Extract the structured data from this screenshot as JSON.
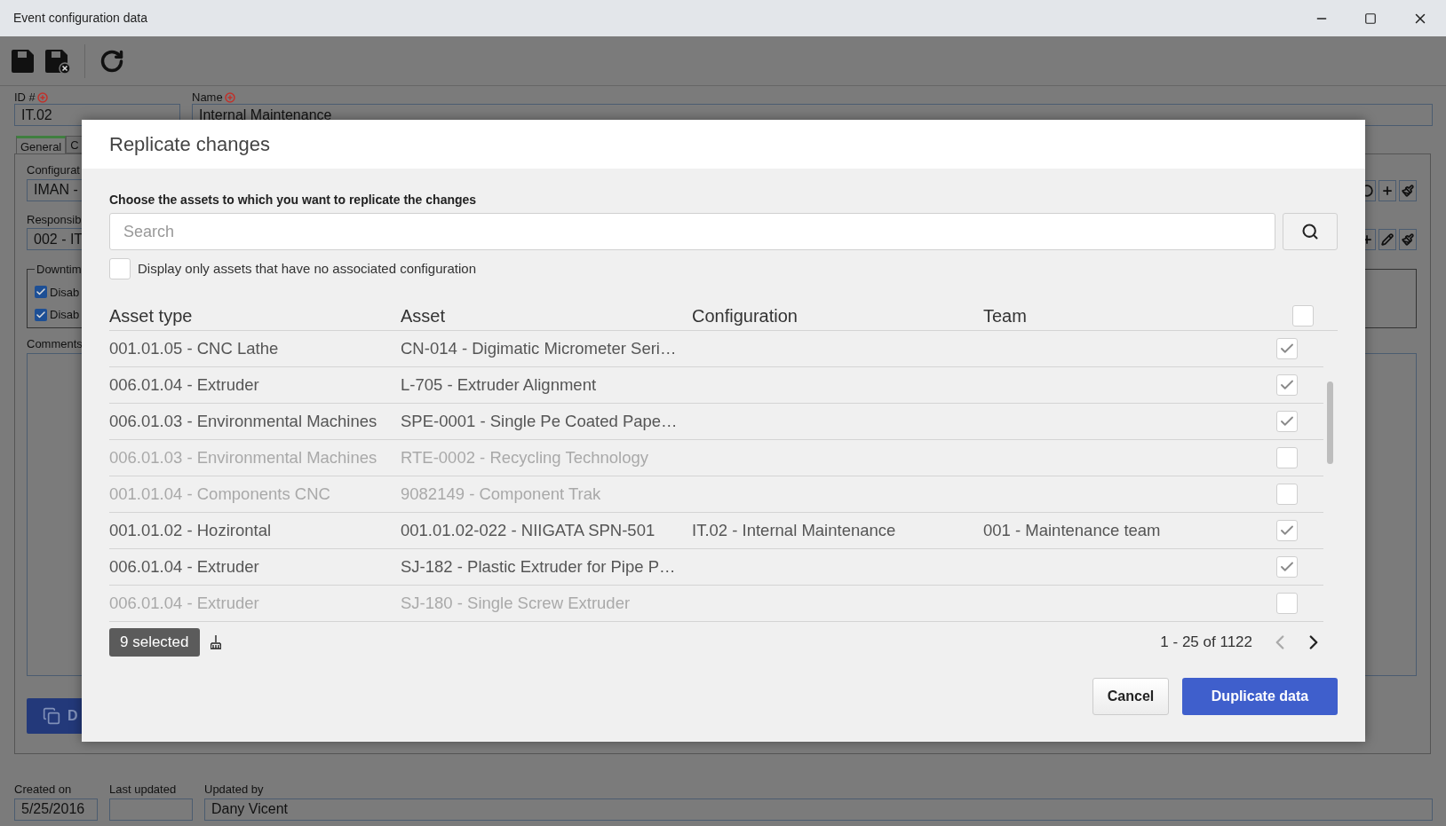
{
  "window": {
    "title": "Event configuration data"
  },
  "form": {
    "id_label": "ID #",
    "id_value": "IT.02",
    "name_label": "Name",
    "name_value": "Internal Maintenance",
    "tabs": [
      {
        "label": "General",
        "selected": true
      },
      {
        "label": "C",
        "selected": false
      }
    ],
    "configuration_label": "Configurat",
    "configuration_value": "IMAN -",
    "responsible_label": "Responsib",
    "responsible_value": "002 - IT",
    "downtime_legend": "Downtim",
    "checkboxes": [
      {
        "label": "Disab",
        "checked": true
      },
      {
        "label": "Disab",
        "checked": true
      }
    ],
    "comments_label": "Comments",
    "duplicate_button": "D",
    "created_on_label": "Created on",
    "created_on_value": "5/25/2016",
    "last_updated_label": "Last updated",
    "updated_by_label": "Updated by",
    "updated_by_value": "Dany Vicent"
  },
  "dialog": {
    "title": "Replicate changes",
    "prompt": "Choose the assets to which you want to replicate the changes",
    "search": {
      "placeholder": "Search"
    },
    "filter": {
      "label": "Display only assets that have no associated configuration",
      "checked": false
    },
    "columns": [
      "Asset type",
      "Asset",
      "Configuration",
      "Team"
    ],
    "select_all": {
      "checked": false
    },
    "rows": [
      {
        "asset_type": "001.01.05 - CNC Lathe",
        "asset": "CN-014 - Digimatic Micrometer Seri…",
        "disabled": false,
        "checked": true
      },
      {
        "asset_type": "006.01.04 - Extruder",
        "asset": "L-705 - Extruder Alignment",
        "disabled": false,
        "checked": true
      },
      {
        "asset_type": "006.01.03 - Environmental Machines",
        "asset": "SPE-0001 - Single Pe Coated Pape…",
        "disabled": false,
        "checked": true
      },
      {
        "asset_type": "006.01.03 - Environmental Machines",
        "asset": "RTE-0002 - Recycling Technology",
        "disabled": true,
        "checked": false
      },
      {
        "asset_type": "001.01.04 - Components CNC",
        "asset": "9082149 - Component Trak",
        "disabled": true,
        "checked": false
      },
      {
        "asset_type": "001.01.02 - Hozirontal",
        "asset": "001.01.02-022 - NIIGATA SPN-501",
        "configuration": "IT.02 - Internal Maintenance",
        "team": "001 - Maintenance team",
        "disabled": false,
        "checked": true
      },
      {
        "asset_type": "006.01.04 - Extruder",
        "asset": "SJ-182 - Plastic Extruder for Pipe P…",
        "disabled": false,
        "checked": true
      },
      {
        "asset_type": "006.01.04 - Extruder",
        "asset": "SJ-180 - Single Screw Extruder",
        "disabled": true,
        "checked": false
      }
    ],
    "selected_count": "9 selected",
    "pager": {
      "text": "1 - 25 of 1122",
      "previous_disabled": true,
      "next_disabled": false
    },
    "cancel_button": "Cancel",
    "confirm_button": "Duplicate data"
  }
}
